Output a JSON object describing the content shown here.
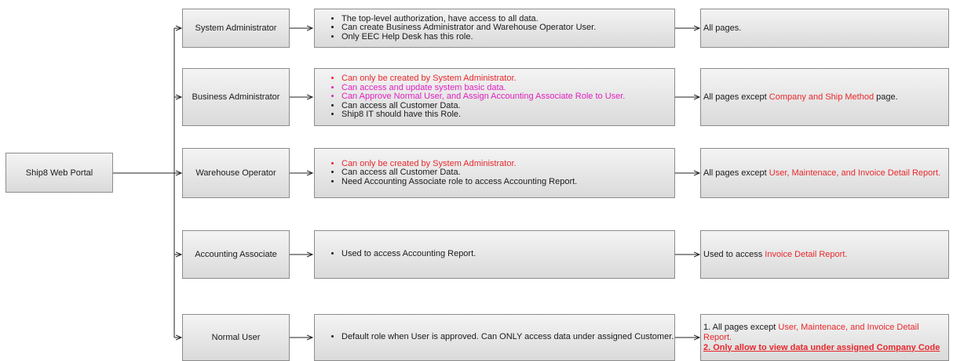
{
  "root": {
    "label": "Ship8 Web Portal"
  },
  "roles": [
    {
      "name": "System Administrator",
      "bullets": [
        {
          "text": "The top-level authorization, have access to all data.",
          "color": "default"
        },
        {
          "text": "Can create Business Administrator and Warehouse Operator User.",
          "color": "default"
        },
        {
          "text": "Only EEC Help Desk has this role.",
          "color": "default"
        }
      ],
      "result_lines": [
        [
          {
            "text": "All pages.",
            "style": "default"
          }
        ]
      ]
    },
    {
      "name": "Business Administrator",
      "bullets": [
        {
          "text": "Can only be created by System Administrator.",
          "color": "red"
        },
        {
          "text": "Can access and update system basic data.",
          "color": "pink"
        },
        {
          "text": "Can Approve Normal User, and Assign Accounting Associate Role to User.",
          "color": "pink"
        },
        {
          "text": "Can access all Customer Data.",
          "color": "default"
        },
        {
          "text": "Ship8 IT should have this Role.",
          "color": "default"
        }
      ],
      "result_lines": [
        [
          {
            "text": "All pages except ",
            "style": "default"
          },
          {
            "text": "Company and Ship Method",
            "style": "red"
          },
          {
            "text": " page.",
            "style": "default"
          }
        ]
      ]
    },
    {
      "name": "Warehouse Operator",
      "bullets": [
        {
          "text": "Can only be created by System Administrator.",
          "color": "red"
        },
        {
          "text": "Can access all Customer Data.",
          "color": "default"
        },
        {
          "text": "Need Accounting Associate role to access Accounting Report.",
          "color": "default"
        }
      ],
      "result_lines": [
        [
          {
            "text": "All pages except ",
            "style": "default"
          },
          {
            "text": "User, Maintenace, and Invoice Detail Report.",
            "style": "red"
          }
        ]
      ]
    },
    {
      "name": "Accounting Associate",
      "bullets": [
        {
          "text": "Used to access Accounting Report.",
          "color": "default"
        }
      ],
      "result_lines": [
        [
          {
            "text": "Used to access ",
            "style": "default"
          },
          {
            "text": "Invoice Detail Report.",
            "style": "red"
          }
        ]
      ]
    },
    {
      "name": "Normal User",
      "bullets": [
        {
          "text": "Default role when User is approved. Can ONLY access data under assigned Customer.",
          "color": "default"
        }
      ],
      "result_lines": [
        [
          {
            "text": "1. All pages except ",
            "style": "default"
          },
          {
            "text": "User, Maintenace, and Invoice Detail Report.",
            "style": "red"
          }
        ],
        [
          {
            "text": "2. Only allow to view data under assigned Company Code",
            "style": "red-bold-underline"
          }
        ]
      ]
    }
  ],
  "colors": {
    "red": "#e8282c",
    "pink": "#e020c0",
    "box_border": "#8c8c8c",
    "line": "#222222"
  }
}
